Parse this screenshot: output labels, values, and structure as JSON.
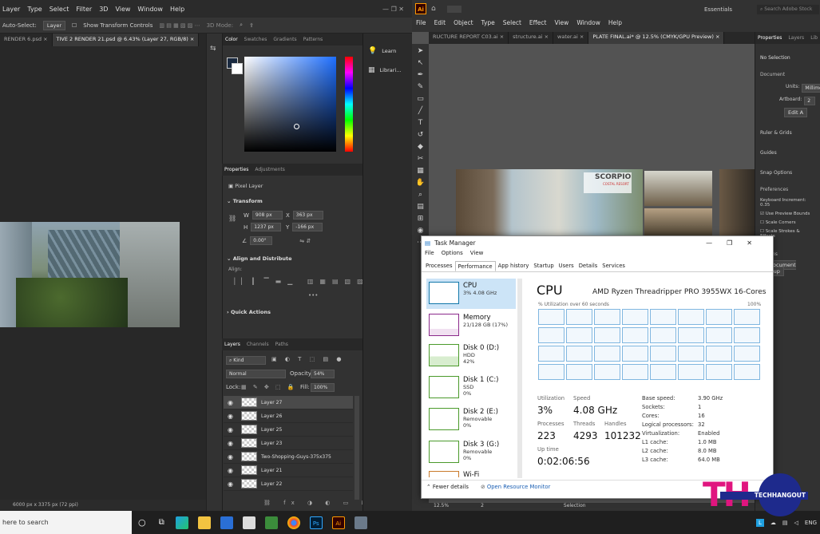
{
  "ps": {
    "menu": [
      "Layer",
      "Type",
      "Select",
      "Filter",
      "3D",
      "View",
      "Window",
      "Help"
    ],
    "auto_select": "Auto-Select:",
    "auto_select_value": "Layer",
    "transform_controls": "Show Transform Controls",
    "mode_3d": "3D Mode:",
    "tabs": [
      "RENDER 6.psd",
      "TIVE 2 RENDER 21.psd @ 6.43% (Layer 27, RGB/8)"
    ],
    "status": "6000 px x 3375 px (72 ppi)",
    "color_tabs": [
      "Color",
      "Swatches",
      "Gradients",
      "Patterns"
    ],
    "props_tabs": [
      "Properties",
      "Adjustments"
    ],
    "pixel_layer": "Pixel Layer",
    "transform": "Transform",
    "w_label": "W",
    "w": "908 px",
    "h_label": "H",
    "h": "1237 px",
    "x_label": "X",
    "x": "363 px",
    "y_label": "Y",
    "y": "-166 px",
    "angle": "0.00°",
    "align_title": "Align and Distribute",
    "align_label": "Align:",
    "quick_actions": "Quick Actions",
    "layers_tabs": [
      "Layers",
      "Channels",
      "Paths"
    ],
    "kind": "Kind",
    "blend": "Normal",
    "opacity_label": "Opacity:",
    "opacity": "54%",
    "lock_label": "Lock:",
    "fill_label": "Fill:",
    "fill": "100%",
    "layers": [
      "Layer 27",
      "Layer 26",
      "Layer 25",
      "Layer 23",
      "Two-Shopping-Guys-375x375",
      "Layer 21",
      "Layer 22"
    ],
    "learn": "Learn",
    "libraries": "Librari..."
  },
  "ai": {
    "logo": "Ai",
    "menu": [
      "File",
      "Edit",
      "Object",
      "Type",
      "Select",
      "Effect",
      "View",
      "Window",
      "Help"
    ],
    "workspace": "Essentials",
    "search_placeholder": "Search Adobe Stock",
    "tabs": [
      "RUCTURE REPORT C03.ai",
      "structure.ai",
      "water.ai",
      "PLATE FINAL.ai* @ 12.5% (CMYK/GPU Preview)"
    ],
    "props_tabs": [
      "Properties",
      "Layers",
      "Lib"
    ],
    "no_selection": "No Selection",
    "document": "Document",
    "units_label": "Units:",
    "units": "Millime",
    "artboard_label": "Artboard:",
    "artboard": "2",
    "edit_btn": "Edit A",
    "rulers": "Ruler & Grids",
    "guides": "Guides",
    "snap": "Snap Options",
    "preferences": "Preferences",
    "keyboard": "Keyboard Increment:",
    "keyboard_val": "0.35",
    "preview_bounds": "Use Preview Bounds",
    "scale_corners": "Scale Corners",
    "scale_strokes": "Scale Strokes & Effects",
    "actions": "Actions",
    "doc_setup": "Document Setup",
    "zoom": "12.5%",
    "page": "2",
    "status_mode": "Selection",
    "banner_title": "SCORPIO",
    "banner_sub": "COSTAL RESORT"
  },
  "tm": {
    "title": "Task Manager",
    "menu": [
      "File",
      "Options",
      "View"
    ],
    "tabs": [
      "Processes",
      "Performance",
      "App history",
      "Startup",
      "Users",
      "Details",
      "Services"
    ],
    "resources": [
      {
        "name": "CPU",
        "sub1": "3% 4.08 GHz",
        "sub2": "",
        "sub3": ""
      },
      {
        "name": "Memory",
        "sub1": "21/128 GB (17%)",
        "sub2": "",
        "sub3": ""
      },
      {
        "name": "Disk 0 (D:)",
        "sub1": "HDD",
        "sub2": "42%",
        "sub3": ""
      },
      {
        "name": "Disk 1 (C:)",
        "sub1": "SSD",
        "sub2": "0%",
        "sub3": ""
      },
      {
        "name": "Disk 2 (E:)",
        "sub1": "Removable",
        "sub2": "0%",
        "sub3": ""
      },
      {
        "name": "Disk 3 (G:)",
        "sub1": "Removable",
        "sub2": "0%",
        "sub3": ""
      },
      {
        "name": "Wi-Fi",
        "sub1": "",
        "sub2": "",
        "sub3": ""
      }
    ],
    "heading": "CPU",
    "model": "AMD Ryzen Threadripper PRO 3955WX 16-Cores",
    "util_label": "% Utilization over 60 seconds",
    "util_max": "100%",
    "utilization_label": "Utilization",
    "utilization": "3%",
    "speed_label": "Speed",
    "speed": "4.08 GHz",
    "processes_label": "Processes",
    "processes": "223",
    "threads_label": "Threads",
    "threads": "4293",
    "handles_label": "Handles",
    "handles": "101232",
    "uptime_label": "Up time",
    "uptime": "0:02:06:56",
    "specs": [
      {
        "k": "Base speed:",
        "v": "3.90 GHz"
      },
      {
        "k": "Sockets:",
        "v": "1"
      },
      {
        "k": "Cores:",
        "v": "16"
      },
      {
        "k": "Logical processors:",
        "v": "32"
      },
      {
        "k": "Virtualization:",
        "v": "Enabled"
      },
      {
        "k": "L1 cache:",
        "v": "1.0 MB"
      },
      {
        "k": "L2 cache:",
        "v": "8.0 MB"
      },
      {
        "k": "L3 cache:",
        "v": "64.0 MB"
      }
    ],
    "fewer": "Fewer details",
    "resmon": "Open Resource Monitor"
  },
  "taskbar": {
    "search": "here to search",
    "ps_label": "Ps",
    "ai_label": "Ai",
    "lang": "ENG"
  },
  "watermark": {
    "mark": "TH",
    "text": "TECHHANGOUT"
  },
  "colors": {
    "ps_accent": "#31a8ff",
    "ai_accent": "#ff9a00",
    "tm_select": "#cce4f7",
    "logo_pink": "#e0157f",
    "logo_blue": "#1e2a8c"
  }
}
